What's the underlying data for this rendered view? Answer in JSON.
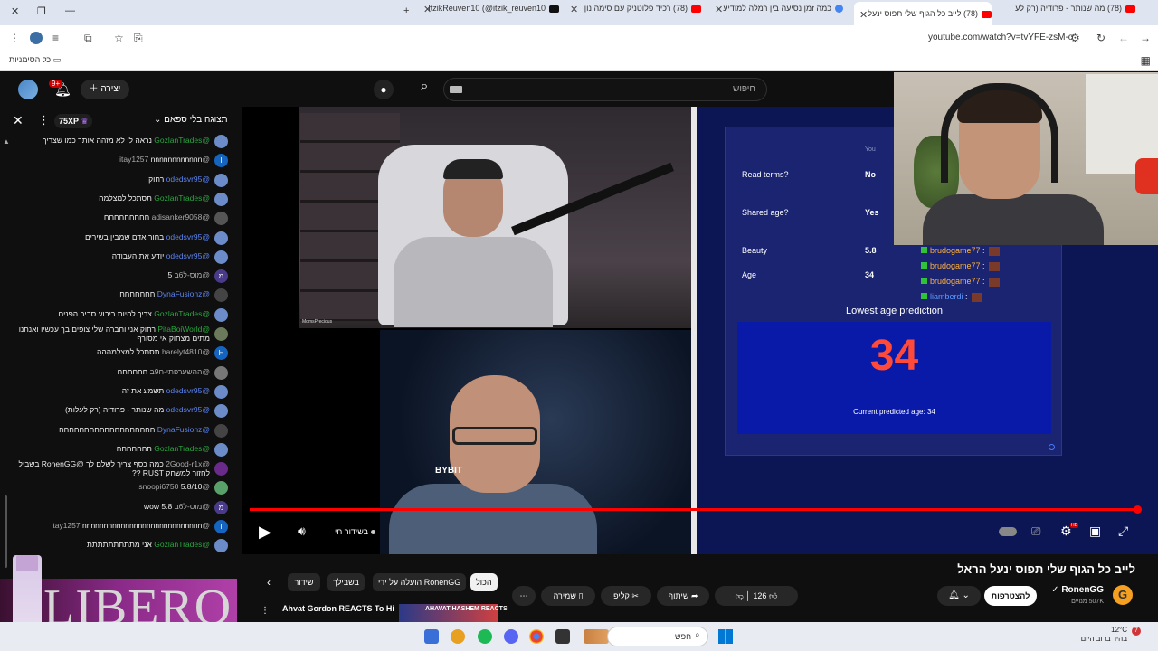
{
  "browser": {
    "tabs": [
      {
        "label": "(78) מה שנותר - פרודיה (רק לע"
      },
      {
        "label": "(78) לייב כל הגוף שלי תפוס ינעל"
      },
      {
        "label": "כמה זמן נסיעה בין רמלה למודיע"
      },
      {
        "label": "(78) רכיד פלוטניק עם סימה נון"
      },
      {
        "label": "ItzikReuven10 (@itzik_reuven10"
      }
    ],
    "url": "youtube.com/watch?v=tvYFE-zsM-o",
    "bookmarks_label": "כל הסימניות"
  },
  "yt": {
    "notif_count": "9+",
    "create_label": "יצירה",
    "search_placeholder": "חיפוש"
  },
  "chat": {
    "title": "תצוגה בלי ספאם",
    "xp": "75XP",
    "messages": [
      {
        "user": "@GozlanTrades",
        "text": "נראה לי לא מזהה אותך כמו שצריך",
        "type": "mem",
        "color": "#6b8cc8",
        "initial": ""
      },
      {
        "user": "@itay1257",
        "text": "nnnnnnnnnnnn",
        "type": "plain",
        "color": "#1565c0",
        "initial": "I"
      },
      {
        "user": "@odedsvr95",
        "text": "רחוק",
        "type": "mod",
        "color": "#6b8cc8",
        "initial": ""
      },
      {
        "user": "@GozlanTrades",
        "text": "תסתכל למצלמה",
        "type": "mem",
        "color": "#6b8cc8",
        "initial": ""
      },
      {
        "user": "@adisanker9058",
        "text": "חחחחחחחחח",
        "type": "plain",
        "color": "#555",
        "initial": ""
      },
      {
        "user": "@odedsvr95",
        "text": "בחור אדם שמבין בשירים",
        "type": "mod",
        "color": "#6b8cc8",
        "initial": ""
      },
      {
        "user": "@odedsvr95",
        "text": "יודע את העבודה",
        "type": "mod",
        "color": "#6b8cc8",
        "initial": ""
      },
      {
        "user": "@מוס-ל6ב",
        "text": "5",
        "type": "plain",
        "color": "#4a3a8a",
        "initial": "מ"
      },
      {
        "user": "@DynaFusionz",
        "text": "חחחחחחח",
        "type": "mod",
        "color": "#444",
        "initial": ""
      },
      {
        "user": "@GozlanTrades",
        "text": "צריך להיות ריבוע סביב הפנים",
        "type": "mem",
        "color": "#6b8cc8",
        "initial": ""
      },
      {
        "user": "@PitaBoiWorld",
        "text": "רחוק אני וחברה שלי צופים בך עכשיו ואנחנו מתים מצחוק אי מסורף",
        "type": "mem",
        "color": "#6a7a5a",
        "initial": ""
      },
      {
        "user": "@harelyt4810",
        "text": "תסתכל למצלמההה",
        "type": "plain",
        "color": "#1565c0",
        "initial": "H"
      },
      {
        "user": "@ההשערפתי-ח9ב",
        "text": "חחחחחח",
        "type": "plain",
        "color": "#777",
        "initial": ""
      },
      {
        "user": "@odedsvr95",
        "text": "תשמע את זה",
        "type": "mod",
        "color": "#6b8cc8",
        "initial": ""
      },
      {
        "user": "@odedsvr95",
        "text": "מה שנותר - פרודיה (רק לעלות)",
        "type": "mod",
        "color": "#6b8cc8",
        "initial": ""
      },
      {
        "user": "@DynaFusionz",
        "text": "חחחחחחחחחחחחחחחחחחח",
        "type": "mod",
        "color": "#444",
        "initial": ""
      },
      {
        "user": "@GozlanTrades",
        "text": "חחחחחחח",
        "type": "mem",
        "color": "#6b8cc8",
        "initial": ""
      },
      {
        "user": "@2Good-r1x",
        "text": "כמה כסף צריך לשלם לך @RonenGG בשביל לחזור למשחק RUST ??",
        "type": "plain",
        "color": "#6a2a8a",
        "initial": ""
      },
      {
        "user": "@snoopi6750",
        "text": "5.8/10",
        "type": "plain",
        "color": "#5aa06a",
        "initial": ""
      },
      {
        "user": "@מוס-ל6ב",
        "text": "wow 5.8",
        "type": "plain",
        "color": "#4a3a8a",
        "initial": "מ"
      },
      {
        "user": "@itay1257",
        "text": "nnnnnnnnnnnnnnnnnnnnnnnnnnnn",
        "type": "plain",
        "color": "#1565c0",
        "initial": "I"
      },
      {
        "user": "@GozlanTrades",
        "text": "אני מתתתתתתתתת",
        "type": "mem",
        "color": "#6b8cc8",
        "initial": ""
      }
    ]
  },
  "ad": {
    "brand": "LIBERO"
  },
  "stream": {
    "cam1_label": "MomsPrecious",
    "sponsor": "BYBIT",
    "game": {
      "you_label": "You",
      "rows": [
        {
          "label": "Read terms?",
          "value": "No"
        },
        {
          "label": "Shared age?",
          "value": "Yes"
        },
        {
          "label": "Beauty",
          "value": "5.8"
        },
        {
          "label": "Age",
          "value": "34"
        }
      ],
      "prediction_title": "Lowest age prediction",
      "prediction_value": "34",
      "prediction_sub": "Current predicted age: 34"
    },
    "overlay_chat": [
      {
        "name": "brudogame77",
        "style": "orange"
      },
      {
        "name": "brudogame77",
        "style": "orange"
      },
      {
        "name": "brudogame77",
        "style": "orange"
      },
      {
        "name": "liamberdi",
        "style": "blue"
      }
    ]
  },
  "player": {
    "live_label": "בשידור חי",
    "progress": 0.995
  },
  "video": {
    "title": "לייב כל הגוף שלי תפוס ינעל הראל",
    "channel": "RonenGG",
    "subs": "507K מנויים",
    "subscribe_label": "להצטרפות",
    "likes": "126",
    "share_label": "שיתוף",
    "clip_label": "קליפ",
    "save_label": "שמירה"
  },
  "chips": [
    "הכול",
    "הועלה על ידי RonenGG",
    "בשבילך",
    "שידור"
  ],
  "recommendation": {
    "title": "Ahvat Gordon REACTS To His Fight! (AHAVAT GORDON vs",
    "thumb_text": "AHAVAT HASHEM REACTS"
  },
  "taskbar": {
    "search_label": "חפש",
    "temp": "12°C",
    "weather": "בהיר ברוב היום",
    "notif": "7"
  }
}
